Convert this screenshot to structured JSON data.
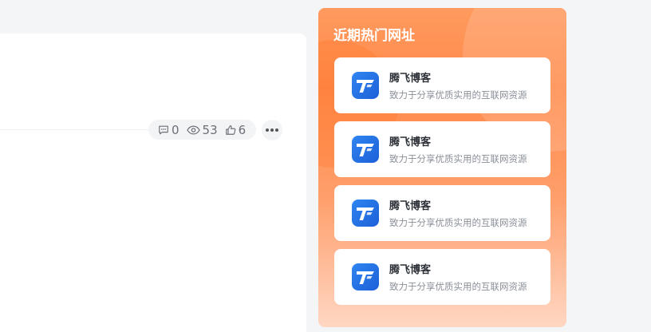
{
  "article": {
    "meta": {
      "comments": "0",
      "views": "53",
      "likes": "6"
    }
  },
  "widget": {
    "title": "近期热门网址",
    "sites": [
      {
        "name": "腾飞博客",
        "description": "致力于分享优质实用的互联网资源",
        "icon": "tengfei-logo-icon"
      },
      {
        "name": "腾飞博客",
        "description": "致力于分享优质实用的互联网资源",
        "icon": "tengfei-logo-icon"
      },
      {
        "name": "腾飞博客",
        "description": "致力于分享优质实用的互联网资源",
        "icon": "tengfei-logo-icon"
      },
      {
        "name": "腾飞博客",
        "description": "致力于分享优质实用的互联网资源",
        "icon": "tengfei-logo-icon"
      }
    ]
  },
  "colors": {
    "accent": "#ff8a4a",
    "logo": "#2f86f0"
  }
}
